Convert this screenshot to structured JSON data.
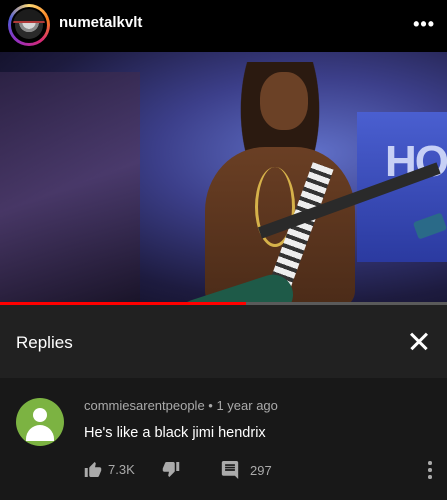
{
  "header": {
    "username": "numetalkvlt",
    "more_icon": "more-dots-icon"
  },
  "video": {
    "stage_text": "HO",
    "progress_fraction": 0.55,
    "progress_color": "#ff0000"
  },
  "replies_panel": {
    "title": "Replies",
    "close_icon": "close-icon"
  },
  "comment": {
    "author": "commiesarentpeople",
    "separator": "•",
    "age": "1 year ago",
    "meta": "commiesarentpeople • 1 year ago",
    "text": "He's like a black jimi hendrix",
    "likes": "7.3K",
    "replies": "297",
    "avatar_color": "#7cb342"
  },
  "colors": {
    "panel_header_bg": "#212121",
    "comment_bg": "#181818",
    "secondary_text": "#aaaaaa"
  }
}
